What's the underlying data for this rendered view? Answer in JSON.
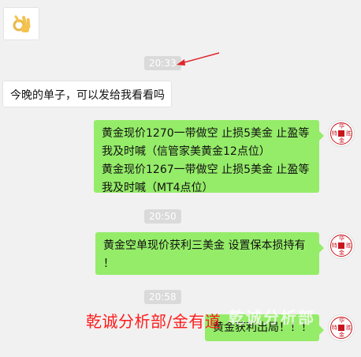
{
  "chat": {
    "emoji_message": {
      "icon": "ok-hand-icon"
    },
    "timestamps": [
      "20:33",
      "20:50",
      "20:58"
    ],
    "incoming_text": "今晚的单子，可以发给我看看吗",
    "msg1_lines": [
      "黄金现价1270一带做空  止损5美金  止盈等",
      "我及时喊（信管家美黄金12点位）",
      "黄金现价1267一带做空  止损5美金  止盈等",
      "我及时喊（MT4点位）"
    ],
    "msg2_lines": [
      "黄金空单现价获利三美金   设置保本损持有",
      "！"
    ],
    "msg3_text": "黄金获利出局！！！",
    "avatar_chars": [
      "华",
      "特",
      "胜",
      "金"
    ],
    "watermark": "乾诚分析部/金有道",
    "faint_watermark": "乾诚分析部"
  },
  "colors": {
    "green_bubble": "#95ec69",
    "arrow": "#e0242b",
    "watermark": "#ff1b1b"
  }
}
